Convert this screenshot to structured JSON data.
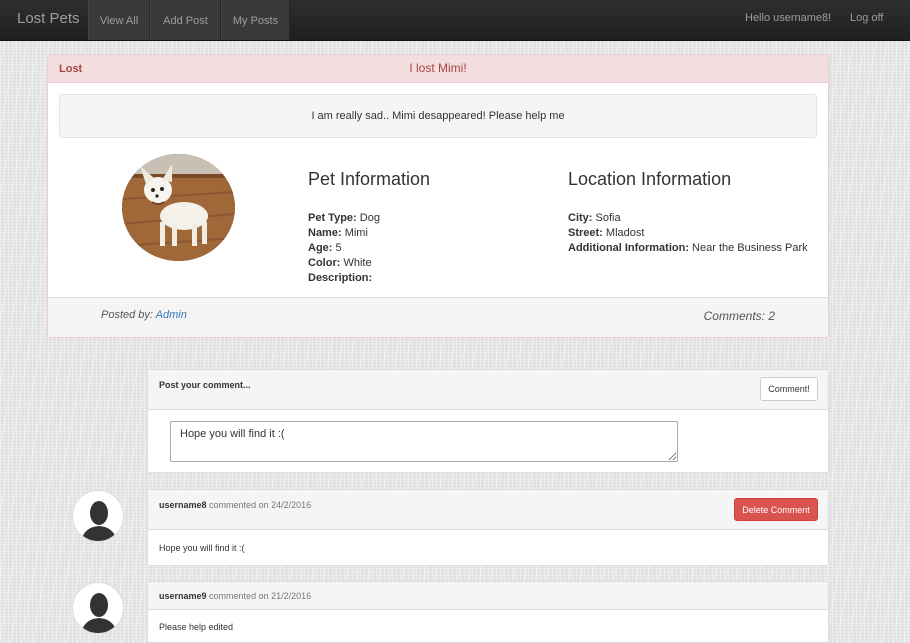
{
  "navbar": {
    "brand": "Lost Pets",
    "items": [
      {
        "label": "View All"
      },
      {
        "label": "Add Post"
      },
      {
        "label": "My Posts"
      }
    ],
    "greeting": "Hello username8!",
    "logoff": "Log off"
  },
  "post": {
    "status": "Lost",
    "title": "I lost Mimi!",
    "description": "I am really sad.. Mimi desappeared! Please help me",
    "pet_info": {
      "heading": "Pet Information",
      "fields": [
        {
          "key": "Pet Type:",
          "value": "Dog"
        },
        {
          "key": "Name:",
          "value": "Mimi"
        },
        {
          "key": "Age:",
          "value": "5"
        },
        {
          "key": "Color:",
          "value": "White"
        },
        {
          "key": "Description:",
          "value": ""
        }
      ]
    },
    "location_info": {
      "heading": "Location Information",
      "fields": [
        {
          "key": "City:",
          "value": "Sofia"
        },
        {
          "key": "Street:",
          "value": "Mladost"
        },
        {
          "key": "Additional Information:",
          "value": "Near the Business Park"
        }
      ]
    },
    "posted_by_label": "Posted by:",
    "posted_by_user": "Admin",
    "comments_count": "Comments: 2"
  },
  "comment_form": {
    "label": "Post your comment...",
    "button": "Comment!",
    "value": "Hope you will find it :("
  },
  "comments": [
    {
      "user": "username8",
      "meta": "commented on 24/2/2016",
      "text": "Hope you will find it :(",
      "delete_label": "Delete Comment"
    },
    {
      "user": "username9",
      "meta": "commented on 21/2/2016",
      "text": "Please help edited"
    }
  ],
  "colors": {
    "navbar": "#222222",
    "danger_header": "#f2dede",
    "danger_text": "#a94442",
    "delete_button": "#d9534f",
    "link": "#337ab7"
  }
}
